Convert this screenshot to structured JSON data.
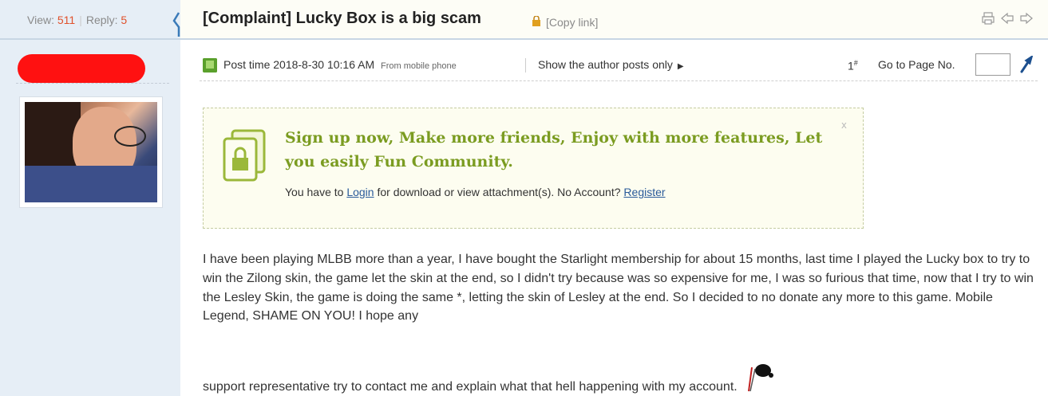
{
  "sidebar": {
    "view_label": "View:",
    "view_count": "511",
    "reply_label": "Reply:",
    "reply_count": "5"
  },
  "thread": {
    "title": "[Complaint] Lucky Box is a big scam",
    "copy_link": "[Copy link]"
  },
  "post_meta": {
    "post_time": "Post time 2018-8-30 10:16 AM",
    "from": "From mobile phone",
    "author_only": "Show the author posts only",
    "floor": "1",
    "floor_sup": "#",
    "goto_label": "Go to Page No.",
    "page_input_value": ""
  },
  "signup": {
    "title": "Sign up now, Make more friends, Enjoy with more features, Let you easily Fun Community.",
    "text_prefix": "You have to ",
    "login_link": "Login",
    "text_middle": " for download or view attachment(s). No Account? ",
    "register_link": "Register",
    "close": "x"
  },
  "post": {
    "body": "I have been playing MLBB more than a year, I have bought the Starlight membership for about 15 months, last time I played the Lucky box to try to win the Zilong skin, the game let the skin at the end, so I didn't try because was so expensive for me, I was so furious that time, now that I try to win the Lesley Skin, the game is doing the same *, letting the skin of Lesley at the end. So I decided to no donate any more to this game. Mobile Legend, SHAME ON YOU! I hope any",
    "body_last": "support representative try to contact me and explain what that hell happening with my account."
  },
  "icons": {
    "lock": "lock-icon",
    "print": "print-icon",
    "prev": "prev-arrow-icon",
    "next": "next-arrow-icon",
    "mobile": "mobile-phone-icon",
    "go": "go-icon",
    "signup": "lock-document-icon",
    "emoji": "angry-emoji-icon"
  },
  "colors": {
    "accent_green": "#7b9c21",
    "link_blue": "#2a5a9a",
    "count_red": "#e0502a",
    "sidebar_bg": "#e6eef6"
  }
}
